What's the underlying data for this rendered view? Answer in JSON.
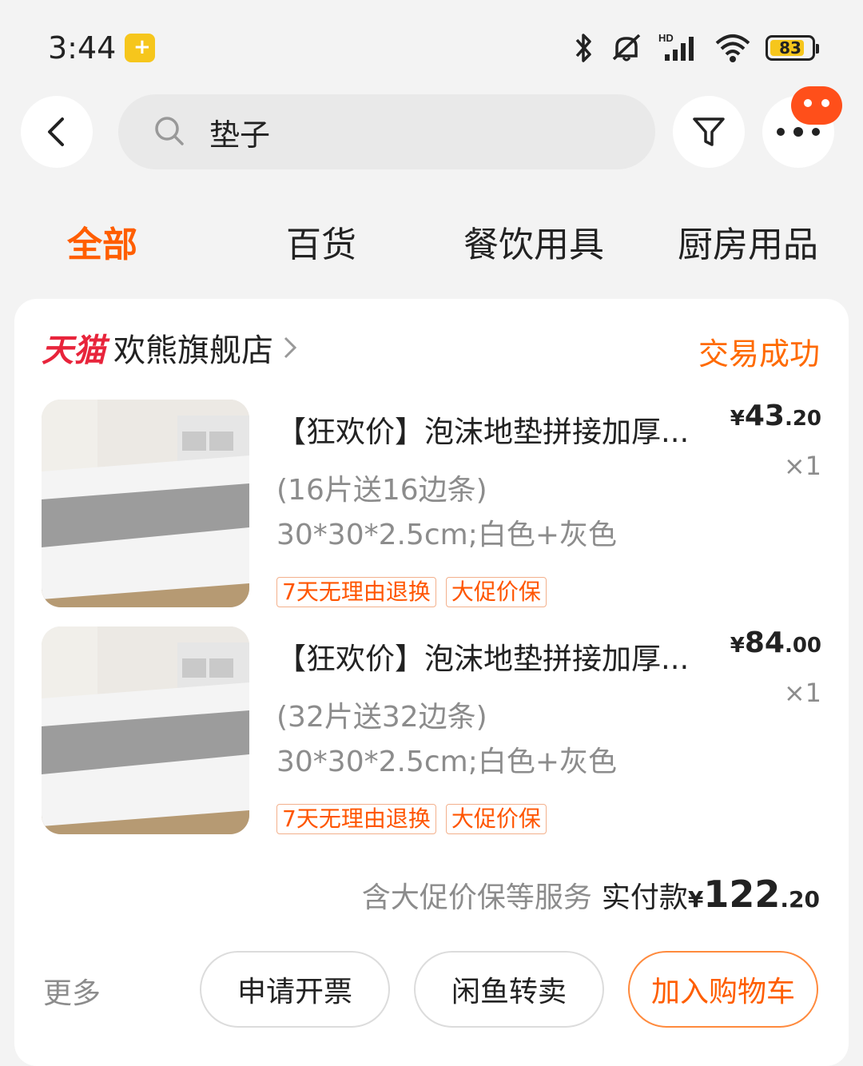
{
  "status_bar": {
    "time": "3:44",
    "battery": "83",
    "battery_level": 0.83,
    "network": "HD"
  },
  "search": {
    "value": "垫子"
  },
  "tabs": [
    {
      "label": "全部",
      "active": true
    },
    {
      "label": "百货",
      "active": false
    },
    {
      "label": "餐饮用具",
      "active": false
    },
    {
      "label": "厨房用品",
      "active": false
    }
  ],
  "store": {
    "platform": "天猫",
    "name": "欢熊旗舰店",
    "order_status": "交易成功"
  },
  "items": [
    {
      "title": "【狂欢价】泡沫地垫拼接加厚...",
      "spec_line1": "(16片送16边条)",
      "spec_line2": "30*30*2.5cm;白色+灰色",
      "price_currency": "¥",
      "price_int": "43",
      "price_dec": ".20",
      "qty": "×1",
      "tags": [
        "7天无理由退换",
        "大促价保"
      ]
    },
    {
      "title": "【狂欢价】泡沫地垫拼接加厚...",
      "spec_line1": "(32片送32边条)",
      "spec_line2": "30*30*2.5cm;白色+灰色",
      "price_currency": "¥",
      "price_int": "84",
      "price_dec": ".00",
      "qty": "×1",
      "tags": [
        "7天无理由退换",
        "大促价保"
      ]
    }
  ],
  "total": {
    "note": "含大促价保等服务",
    "label": "实付款",
    "currency": "¥",
    "int": "122",
    "dec": ".20"
  },
  "actions": {
    "more": "更多",
    "invoice": "申请开票",
    "resell": "闲鱼转卖",
    "add_cart": "加入购物车"
  },
  "colors": {
    "accent": "#ff5e00",
    "tmall": "#e8243b",
    "background": "#f3f3f3"
  },
  "icons": [
    "back-icon",
    "search-icon",
    "filter-icon",
    "more-icon",
    "bluetooth-icon",
    "mute-icon",
    "signal-icon",
    "wifi-icon",
    "battery-icon",
    "chevron-right-icon"
  ]
}
